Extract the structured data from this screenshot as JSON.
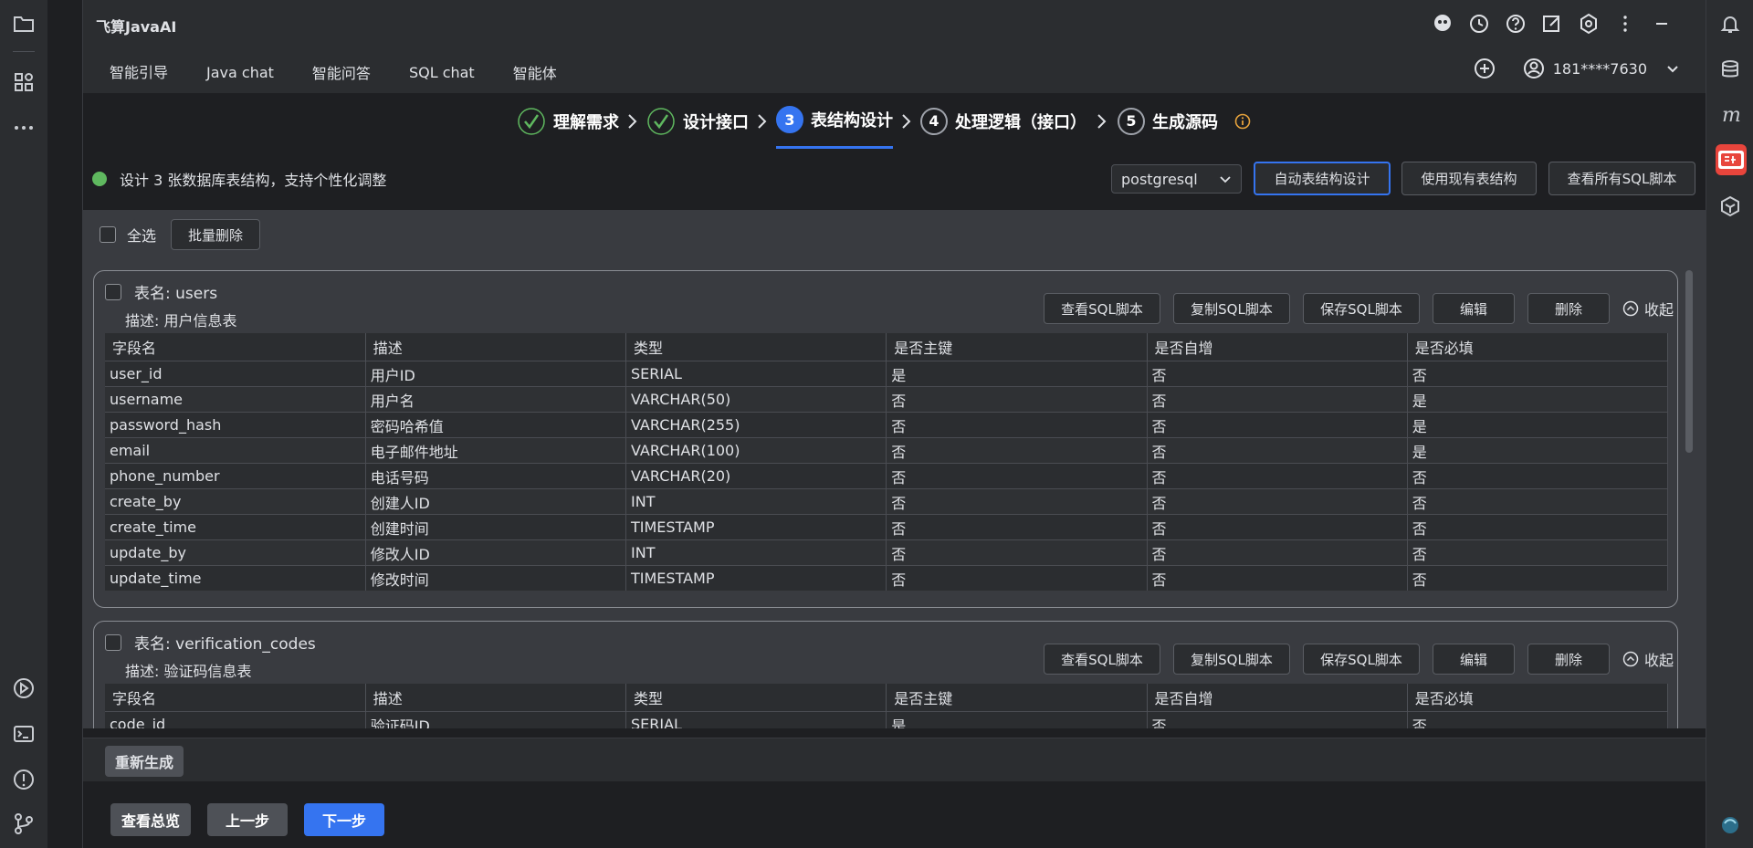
{
  "app": {
    "title": "飞算JavaAI"
  },
  "tabs": [
    {
      "label": "智能引导",
      "active": true
    },
    {
      "label": "Java chat"
    },
    {
      "label": "智能问答"
    },
    {
      "label": "SQL chat"
    },
    {
      "label": "智能体"
    }
  ],
  "user": {
    "name": "181****7630"
  },
  "steps": [
    {
      "num": "✓",
      "label": "理解需求",
      "state": "done"
    },
    {
      "num": "✓",
      "label": "设计接口",
      "state": "done"
    },
    {
      "num": "3",
      "label": "表结构设计",
      "state": "active"
    },
    {
      "num": "4",
      "label": "处理逻辑（接口）",
      "state": "todo"
    },
    {
      "num": "5",
      "label": "生成源码",
      "state": "todo"
    }
  ],
  "info": {
    "text": "设计 3 张数据库表结构，支持个性化调整"
  },
  "db": {
    "selected": "postgresql"
  },
  "toolbar": {
    "auto_design": "自动表结构设计",
    "use_existing": "使用现有表结构",
    "view_all_sql": "查看所有SQL脚本"
  },
  "select_all": {
    "label": "全选",
    "batch_delete": "批量删除"
  },
  "card_actions": {
    "view_sql": "查看SQL脚本",
    "copy_sql": "复制SQL脚本",
    "save_sql": "保存SQL脚本",
    "edit": "编辑",
    "delete": "删除",
    "collapse": "收起"
  },
  "columns": [
    "字段名",
    "描述",
    "类型",
    "是否主键",
    "是否自增",
    "是否必填"
  ],
  "tables": [
    {
      "name": "表名: users",
      "desc": "描述: 用户信息表",
      "rows": [
        [
          "user_id",
          "用户ID",
          "SERIAL",
          "是",
          "否",
          "否"
        ],
        [
          "username",
          "用户名",
          "VARCHAR(50)",
          "否",
          "否",
          "是"
        ],
        [
          "password_hash",
          "密码哈希值",
          "VARCHAR(255)",
          "否",
          "否",
          "是"
        ],
        [
          "email",
          "电子邮件地址",
          "VARCHAR(100)",
          "否",
          "否",
          "是"
        ],
        [
          "phone_number",
          "电话号码",
          "VARCHAR(20)",
          "否",
          "否",
          "否"
        ],
        [
          "create_by",
          "创建人ID",
          "INT",
          "否",
          "否",
          "否"
        ],
        [
          "create_time",
          "创建时间",
          "TIMESTAMP",
          "否",
          "否",
          "否"
        ],
        [
          "update_by",
          "修改人ID",
          "INT",
          "否",
          "否",
          "否"
        ],
        [
          "update_time",
          "修改时间",
          "TIMESTAMP",
          "否",
          "否",
          "否"
        ]
      ]
    },
    {
      "name": "表名: verification_codes",
      "desc": "描述: 验证码信息表",
      "rows": [
        [
          "code_id",
          "验证码ID",
          "SERIAL",
          "是",
          "否",
          "否"
        ]
      ]
    }
  ],
  "bottom": {
    "regenerate": "重新生成",
    "overview": "查看总览",
    "prev": "上一步",
    "next": "下一步"
  },
  "colors": {
    "accent": "#3574f0",
    "success": "#5fb85f",
    "warning": "#e6a23c",
    "bg": "#1e1f22",
    "panel": "#2b2d30"
  }
}
